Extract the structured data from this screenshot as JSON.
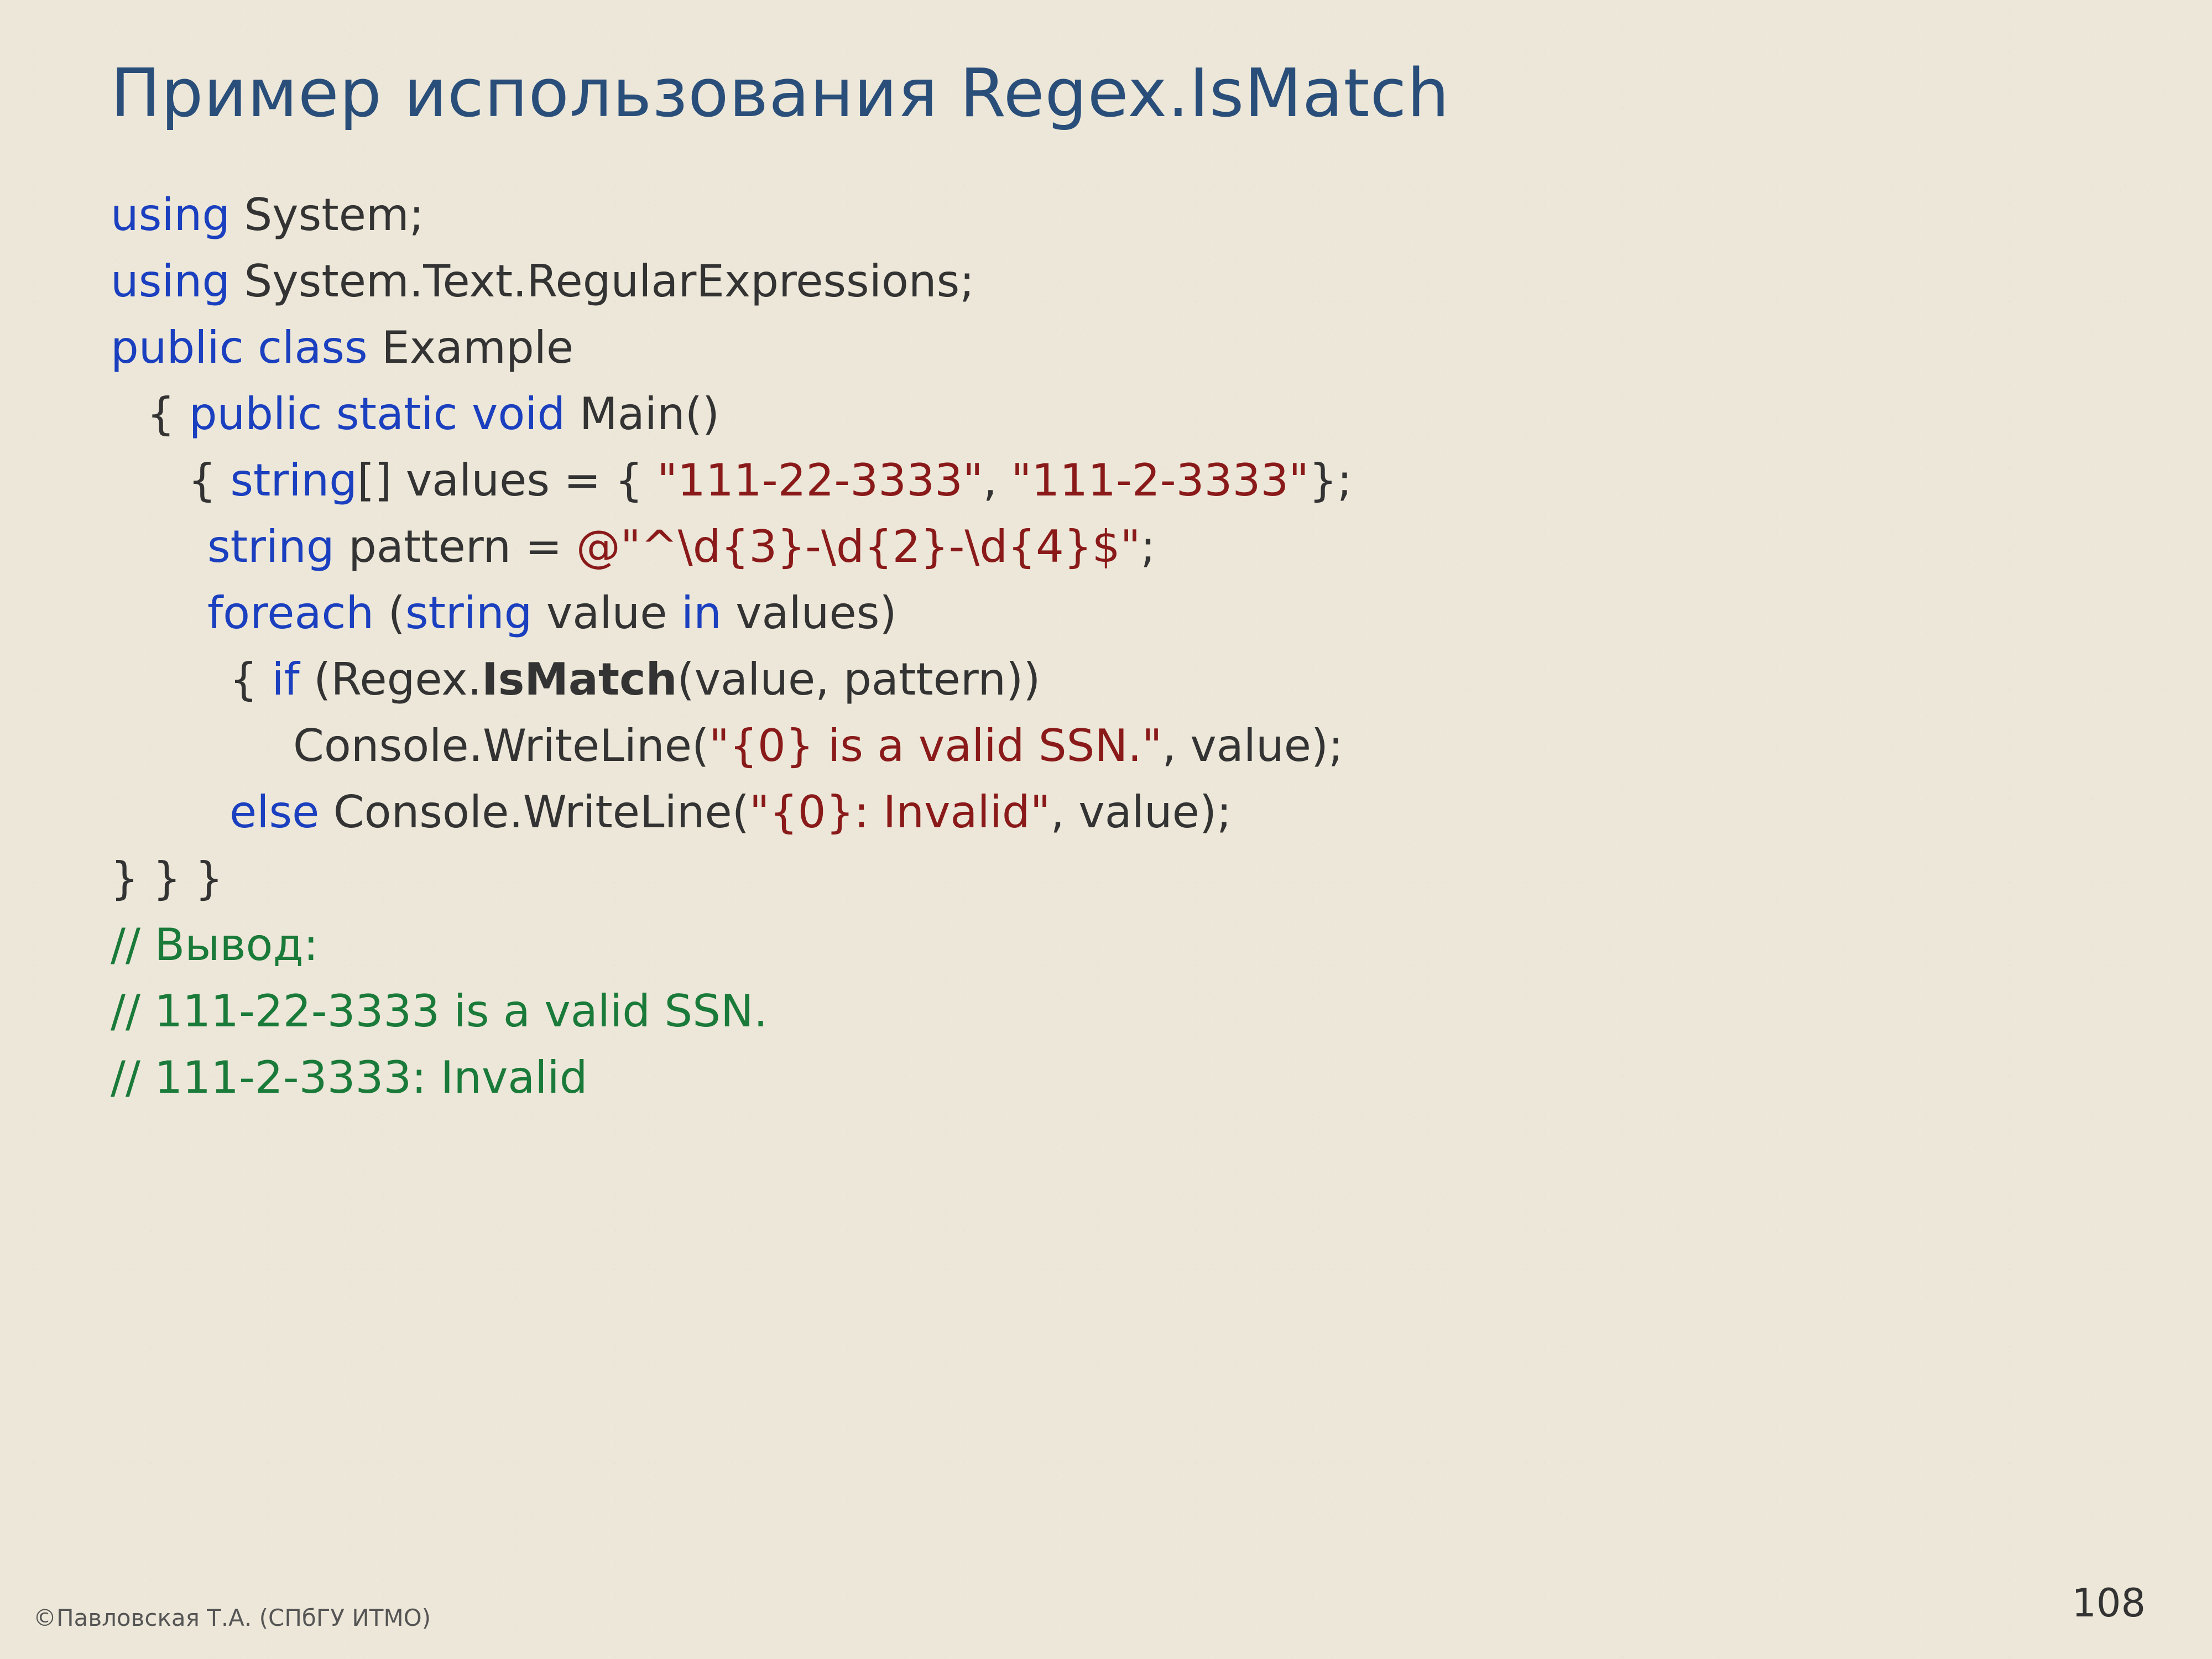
{
  "title": "Пример использования Regex.IsMatch",
  "footer": {
    "copyright": "©Павловская Т.А. (СПбГУ ИТМО)",
    "page": "108"
  },
  "code": {
    "l1": {
      "kw": "using",
      "t": " System;"
    },
    "l2": {
      "kw": "using",
      "t": " System.Text.RegularExpressions;"
    },
    "l3": {
      "kw": "public class",
      "t": " Example"
    },
    "l4": {
      "pre": " { ",
      "kw": "public static void",
      "t": " Main()"
    },
    "l5": {
      "pre": "{ ",
      "kw": "string",
      "t1": "[] values = { ",
      "s1": "\"111-22-3333\"",
      "t2": ", ",
      "s2": "\"111-2-3333\"",
      "t3": "};"
    },
    "l6": {
      "kw": "string",
      "t1": " pattern = ",
      "s1": "@\"^\\d{3}-\\d{2}-\\d{4}$\"",
      "t2": ";"
    },
    "l7": {
      "kw1": "foreach",
      "t1": " (",
      "kw2": "string",
      "t2": " value ",
      "kw3": "in",
      "t3": " values)"
    },
    "l8": {
      "pre": "{ ",
      "kw": "if",
      "t1": " (Regex.",
      "b": "IsMatch",
      "t2": "(value, pattern))"
    },
    "l9": {
      "t1": "Console.WriteLine(",
      "s": "\"{0} is a valid SSN.\"",
      "t2": ", value);"
    },
    "l10": {
      "kw": "else",
      "t1": " Console.WriteLine(",
      "s": "\"{0}: Invalid\"",
      "t2": ", value);"
    },
    "l11": {
      "t": "} } }"
    },
    "c1": "// Вывод:",
    "c2": "// 111-22-3333 is a valid SSN.",
    "c3": "// 111-2-3333: Invalid"
  }
}
